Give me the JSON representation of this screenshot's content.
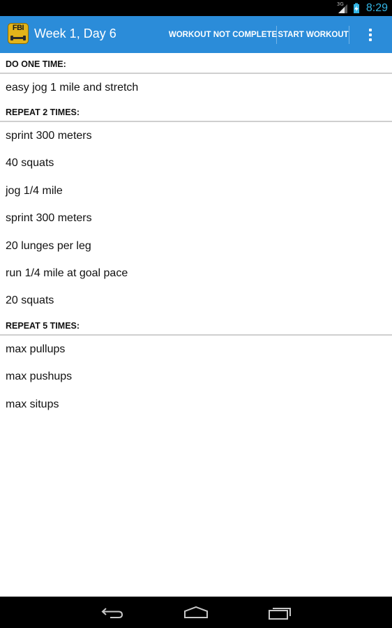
{
  "status_bar": {
    "network_label": "3G",
    "time": "8:29"
  },
  "action_bar": {
    "app_icon_text": "FBI",
    "title": "Week 1, Day 6",
    "workout_not_complete_label": "WORKOUT NOT COMPLETE",
    "start_workout_label": "START WORKOUT"
  },
  "sections": [
    {
      "header": "DO ONE TIME:",
      "items": [
        "easy jog 1 mile and stretch"
      ]
    },
    {
      "header": "REPEAT 2 TIMES:",
      "items": [
        "sprint 300 meters",
        "40 squats",
        "jog 1/4 mile",
        "sprint 300 meters",
        "20 lunges per leg",
        "run 1/4 mile at goal pace",
        "20 squats"
      ]
    },
    {
      "header": "REPEAT 5 TIMES:",
      "items": [
        "max pullups",
        "max pushups",
        "max situps"
      ]
    }
  ],
  "colors": {
    "action_bar": "#2b8cd9",
    "status_accent": "#33b5e5",
    "divider": "#cfcfcf"
  },
  "icons": {
    "signal": "signal-icon",
    "battery": "battery-charging-icon",
    "overflow": "overflow-menu-icon",
    "back": "back-icon",
    "home": "home-icon",
    "recent": "recent-apps-icon"
  }
}
